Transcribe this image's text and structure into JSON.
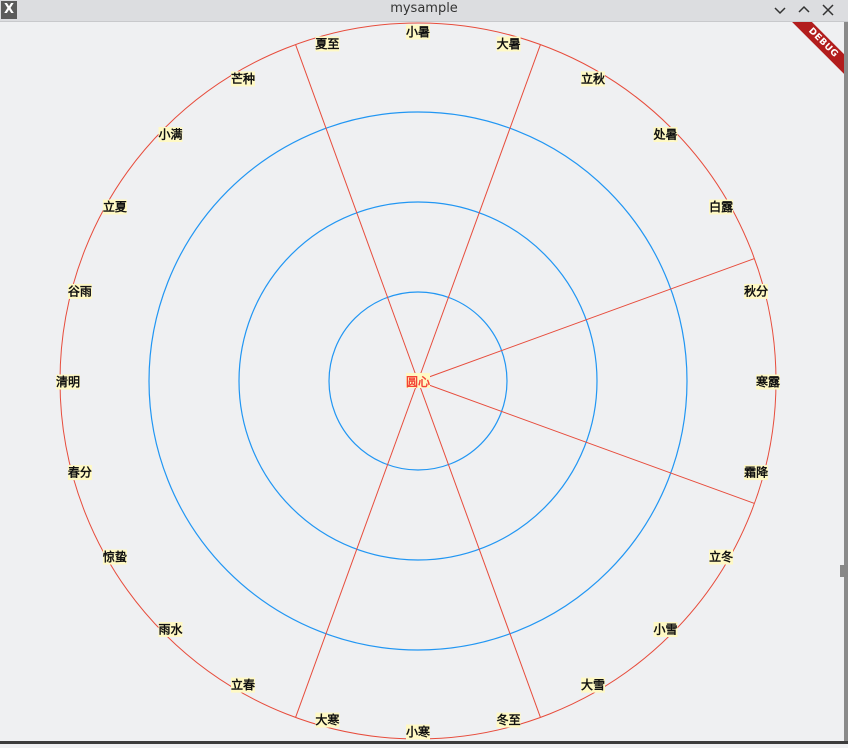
{
  "window": {
    "title": "mysample",
    "app_icon": "X",
    "minimize_icon": "chevron-down-icon",
    "maximize_icon": "chevron-up-icon",
    "close_icon": "close-icon"
  },
  "debug_banner": "DEBUG",
  "diagram": {
    "center_label": "圆心",
    "colors": {
      "outer_circle": "#e74c3c",
      "spokes": "#e74c3c",
      "rings": "#2196f3",
      "center_text": "#f44336",
      "label_bg": "#fff9c4"
    },
    "solar_terms": [
      "小暑",
      "大暑",
      "立秋",
      "处暑",
      "白露",
      "秋分",
      "寒露",
      "霜降",
      "立冬",
      "小雪",
      "大雪",
      "冬至",
      "小寒",
      "大寒",
      "立春",
      "雨水",
      "惊蛰",
      "春分",
      "清明",
      "谷雨",
      "立夏",
      "小满",
      "芒种",
      "夏至"
    ],
    "spoke_count": 6,
    "ring_count": 3
  }
}
